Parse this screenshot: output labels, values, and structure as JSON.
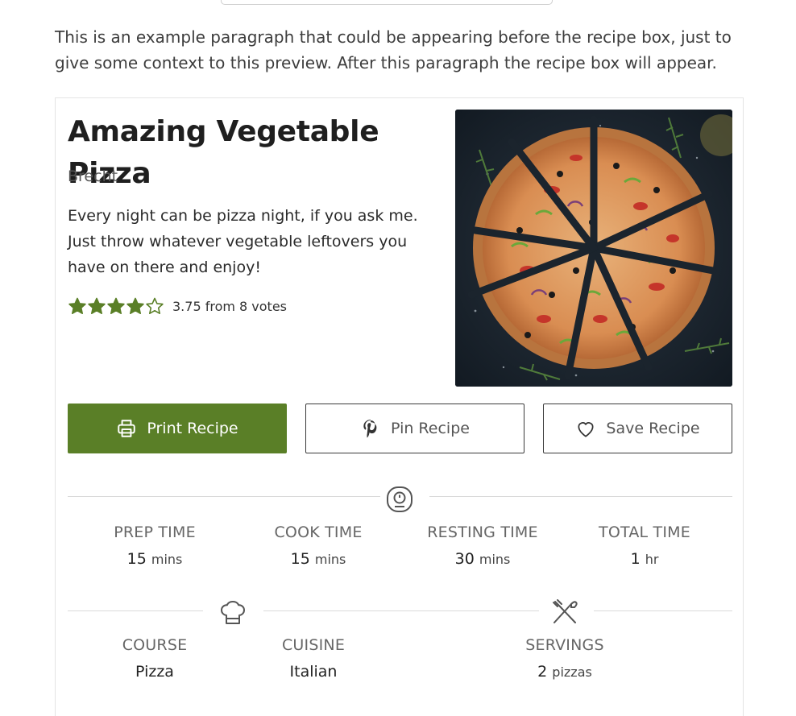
{
  "intro": {
    "paragraph": "This is an example paragraph that could be appearing before the recipe box, just to give some context to this preview. After this paragraph the recipe box will appear."
  },
  "recipe": {
    "title": "Amazing Vegetable Pizza",
    "author": "Brecht",
    "summary": "Every night can be pizza night, if you ask me. Just throw whatever vegetable leftovers you have on there and enjoy!",
    "rating": {
      "value": 3.75,
      "max": 5,
      "text": "3.75 from 8 votes",
      "star_color": "#5a7f27"
    },
    "image_icon": "pizza-photo"
  },
  "buttons": {
    "print_label": "Print Recipe",
    "pin_label": "Pin Recipe",
    "save_label": "Save Recipe",
    "print_color": "#5a7f27"
  },
  "times": {
    "icon": "timer-icon",
    "items": [
      {
        "label": "PREP TIME",
        "value": "15",
        "unit": "mins"
      },
      {
        "label": "COOK TIME",
        "value": "15",
        "unit": "mins"
      },
      {
        "label": "RESTING TIME",
        "value": "30",
        "unit": "mins"
      },
      {
        "label": "TOTAL TIME",
        "value": "1",
        "unit": "hr"
      }
    ]
  },
  "details": {
    "course": {
      "label": "COURSE",
      "value": "Pizza",
      "icon": "chef-hat-icon"
    },
    "cuisine": {
      "label": "CUISINE",
      "value": "Italian"
    },
    "servings": {
      "label": "SERVINGS",
      "value": "2",
      "unit": "pizzas",
      "icon": "fork-knife-icon"
    }
  }
}
